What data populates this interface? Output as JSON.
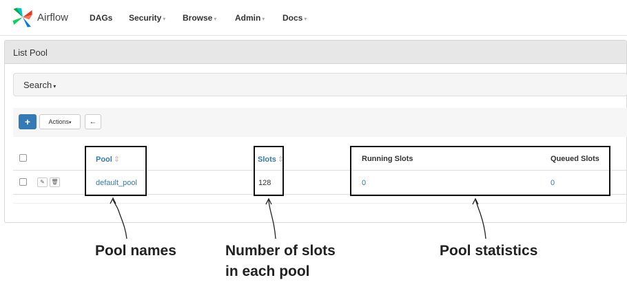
{
  "app": {
    "brand": "Airflow",
    "accent_color": "#337ab7"
  },
  "nav": {
    "dags": "DAGs",
    "security": "Security",
    "browse": "Browse",
    "admin": "Admin",
    "docs": "Docs"
  },
  "panel": {
    "title": "List Pool"
  },
  "search": {
    "label": "Search"
  },
  "toolbar": {
    "add_icon": "plus-icon",
    "actions_label": "Actions",
    "back_icon": "arrow-left-icon"
  },
  "table": {
    "columns": {
      "pool": "Pool",
      "slots": "Slots",
      "running_slots": "Running Slots",
      "queued_slots": "Queued Slots"
    },
    "rows": [
      {
        "pool": "default_pool",
        "slots": "128",
        "running_slots": "0",
        "queued_slots": "0"
      }
    ]
  },
  "annotations": {
    "pool_names": "Pool names",
    "slots_line1": "Number of slots",
    "slots_line2": "in each pool",
    "pool_statistics": "Pool statistics"
  }
}
